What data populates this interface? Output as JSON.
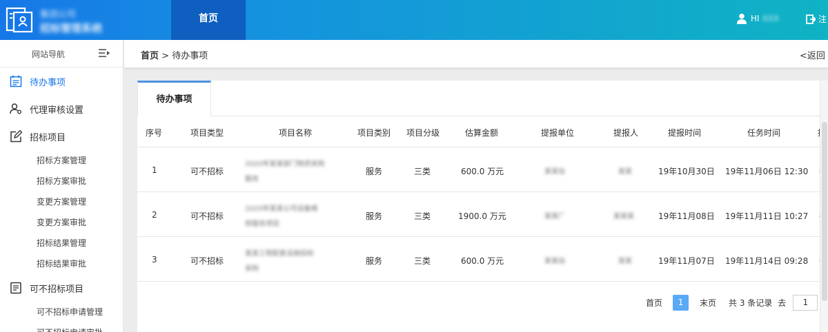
{
  "header": {
    "logo_line1": "集团公司",
    "logo_line2": "招标管理系统",
    "nav_home": "首页",
    "user_greeting": "HI",
    "user_name": "XXX",
    "logout_label": "注"
  },
  "sidebar": {
    "title": "网站导航",
    "items": [
      {
        "label": "待办事项",
        "icon": "calendar-list-icon",
        "active": true
      },
      {
        "label": "代理审核设置",
        "icon": "user-settings-icon"
      },
      {
        "label": "招标项目",
        "icon": "edit-icon"
      },
      {
        "label": "招标方案管理"
      },
      {
        "label": "招标方案审批"
      },
      {
        "label": "变更方案管理"
      },
      {
        "label": "变更方案审批"
      },
      {
        "label": "招标结果管理"
      },
      {
        "label": "招标结果审批"
      },
      {
        "label": "可不招标项目",
        "icon": "document-icon"
      },
      {
        "label": "可不招标申请管理"
      },
      {
        "label": "可不招标申请审批"
      }
    ]
  },
  "breadcrumb": {
    "home": "首页",
    "sep": ">",
    "current": "待办事项",
    "back": "<返回"
  },
  "tabs": [
    {
      "label": "待办事项"
    }
  ],
  "table": {
    "headers": [
      "序号",
      "项目类型",
      "项目名称",
      "项目类别",
      "项目分级",
      "估算金额",
      "提报单位",
      "提报人",
      "提报时间",
      "任务时间",
      "提"
    ],
    "rows": [
      {
        "no": "1",
        "type": "可不招标",
        "name1": "2020年某某部门物资采购",
        "name2": "服务",
        "category": "服务",
        "level": "三类",
        "amount": "600.0 万元",
        "unit": "某某站",
        "person": "某某",
        "report_time": "19年10月30日",
        "task_time": "19年11月06日 12:30",
        "extra": "待"
      },
      {
        "no": "2",
        "type": "可不招标",
        "name1": "2020年某某公司设备维",
        "name2": "修服务项目",
        "category": "服务",
        "level": "三类",
        "amount": "1900.0 万元",
        "unit": "某某厂",
        "person": "某某某",
        "report_time": "19年11月08日",
        "task_time": "19年11月11日 10:27",
        "extra": "待"
      },
      {
        "no": "3",
        "type": "可不招标",
        "name1": "某某工程配套设施招标",
        "name2": "采购",
        "category": "服务",
        "level": "三类",
        "amount": "600.0 万元",
        "unit": "某某站",
        "person": "某某",
        "report_time": "19年11月07日",
        "task_time": "19年11月14日 09:28",
        "extra": "待"
      }
    ]
  },
  "pager": {
    "first": "首页",
    "current": "1",
    "last": "末页",
    "total": "共 3 条记录",
    "goto": "去",
    "input": "1",
    "slash": "/"
  },
  "colors": {
    "primary": "#1677e8",
    "header_active": "#0e5fc0",
    "tab_accent": "#4a90e2",
    "page_current": "#5aa9f5"
  }
}
